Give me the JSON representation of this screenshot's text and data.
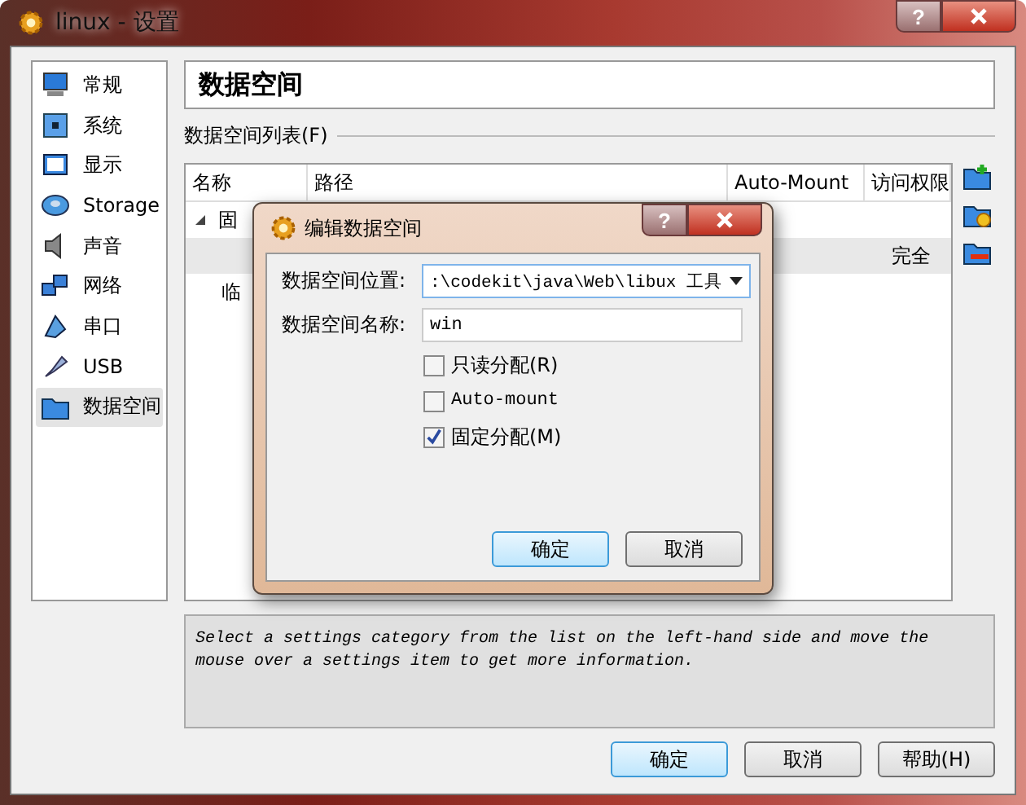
{
  "window": {
    "title": "linux - 设置",
    "help": "?"
  },
  "sidebar": {
    "items": [
      {
        "label": "常规",
        "selected": false
      },
      {
        "label": "系统",
        "selected": false
      },
      {
        "label": "显示",
        "selected": false
      },
      {
        "label": "Storage",
        "selected": false
      },
      {
        "label": "声音",
        "selected": false
      },
      {
        "label": "网络",
        "selected": false
      },
      {
        "label": "串口",
        "selected": false
      },
      {
        "label": "USB",
        "selected": false
      },
      {
        "label": "数据空间",
        "selected": true
      }
    ]
  },
  "page_title": "数据空间",
  "group_label": "数据空间列表(F)",
  "table": {
    "columns": [
      "名称",
      "路径",
      "Auto-Mount",
      "访问权限"
    ],
    "rows": [
      {
        "kind": "branch",
        "name": "固",
        "expanded": true,
        "access": "",
        "selected": false
      },
      {
        "kind": "leaf",
        "name": "",
        "access": "完全",
        "selected": true
      },
      {
        "kind": "leaf",
        "name": "临",
        "access": "",
        "selected": false
      }
    ]
  },
  "info": "Select a settings category from the list on the left-hand side and move the mouse over a settings item to get more information.",
  "buttons": [
    {
      "label": "确定",
      "default": true
    },
    {
      "label": "取消",
      "default": false
    },
    {
      "label": "帮助(H)",
      "default": false
    }
  ],
  "dialog": {
    "title": "编辑数据空间",
    "help": "?",
    "fields": [
      {
        "kind": "combo",
        "label": "数据空间位置:",
        "value": ":\\codekit\\java\\Web\\libux 工具"
      },
      {
        "kind": "text",
        "label": "数据空间名称:",
        "value": "win"
      }
    ],
    "checkboxes": [
      {
        "label": "只读分配(R)",
        "checked": false
      },
      {
        "label": "Auto-mount",
        "checked": false
      },
      {
        "label": "固定分配(M)",
        "checked": true
      }
    ],
    "buttons": [
      {
        "label": "确定",
        "default": true
      },
      {
        "label": "取消",
        "default": false
      }
    ]
  }
}
